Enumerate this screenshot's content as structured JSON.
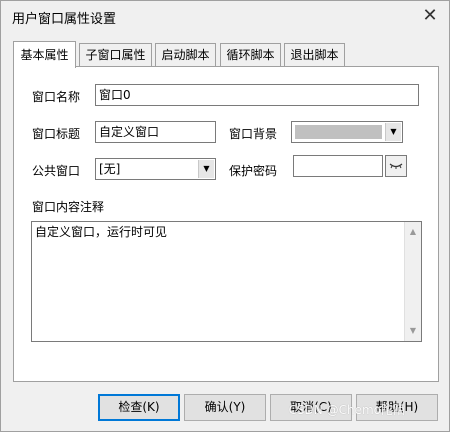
{
  "window": {
    "title": "用户窗口属性设置",
    "close_glyph": "✕"
  },
  "tabs": [
    {
      "label": "基本属性",
      "active": true
    },
    {
      "label": "子窗口属性",
      "active": false
    },
    {
      "label": "启动脚本",
      "active": false
    },
    {
      "label": "循环脚本",
      "active": false
    },
    {
      "label": "退出脚本",
      "active": false
    }
  ],
  "form": {
    "window_name_label": "窗口名称",
    "window_name_value": "窗口0",
    "window_title_label": "窗口标题",
    "window_title_value": "自定义窗口",
    "window_background_label": "窗口背景",
    "window_background_color": "#c0c0c0",
    "public_window_label": "公共窗口",
    "public_window_value": "[无]",
    "password_label": "保护密码",
    "password_value": "",
    "comment_label": "窗口内容注释",
    "comment_value": "自定义窗口，运行时可见"
  },
  "buttons": {
    "check": "检查(K)",
    "confirm": "确认(Y)",
    "cancel": "取消(C)",
    "help": "帮助(H)"
  },
  "watermark": "CSDN @Chemo陀陌",
  "icons": {
    "close": "close-icon",
    "dropdown": "chevron-down-icon",
    "key": "key-icon",
    "scroll_up": "scroll-up-icon",
    "scroll_down": "scroll-down-icon"
  }
}
